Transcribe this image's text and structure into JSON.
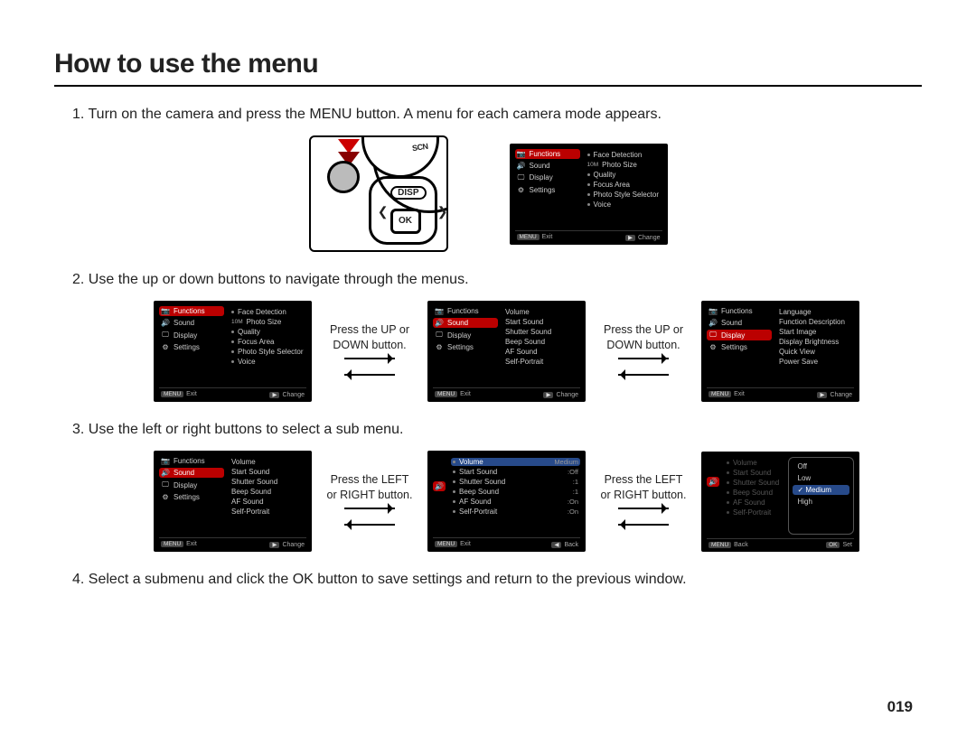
{
  "title": "How to use the menu",
  "page_number": "019",
  "steps": {
    "s1": "1. Turn on the camera and press the MENU button. A menu for each camera mode appears.",
    "s2": "2. Use the up or down buttons to navigate through the menus.",
    "s3": "3. Use the left or right buttons to select a sub menu.",
    "s4": "4. Select a submenu and click the OK button to save settings and return to the previous window."
  },
  "captions": {
    "updown": "Press the UP or DOWN button.",
    "leftright": "Press the LEFT or RIGHT button."
  },
  "camera": {
    "dial_label": "SCN",
    "disp": "DISP",
    "ok": "OK"
  },
  "icons": {
    "functions": "📷",
    "sound": "🔊",
    "display": "🖵",
    "settings": "⚙"
  },
  "menu_footer": {
    "exit_tag": "MENU",
    "exit": "Exit",
    "change_tag": "▶",
    "change": "Change",
    "back_tag": "◀",
    "back": "Back",
    "set_tag": "OK",
    "set": "Set"
  },
  "panels": {
    "p1": {
      "left": [
        {
          "icon": "functions",
          "label": "Functions",
          "sel": true
        },
        {
          "icon": "sound",
          "label": "Sound"
        },
        {
          "icon": "display",
          "label": "Display"
        },
        {
          "icon": "settings",
          "label": "Settings"
        }
      ],
      "right": [
        {
          "bullet": true,
          "label": "Face Detection"
        },
        {
          "pre": "10M",
          "label": "Photo Size"
        },
        {
          "bullet": true,
          "label": "Quality"
        },
        {
          "bullet": true,
          "label": "Focus Area"
        },
        {
          "bullet": true,
          "label": "Photo Style Selector"
        },
        {
          "bullet": true,
          "label": "Voice"
        }
      ]
    },
    "p2a": {
      "left": [
        {
          "icon": "functions",
          "label": "Functions",
          "sel": true
        },
        {
          "icon": "sound",
          "label": "Sound"
        },
        {
          "icon": "display",
          "label": "Display"
        },
        {
          "icon": "settings",
          "label": "Settings"
        }
      ],
      "right": [
        {
          "bullet": true,
          "label": "Face Detection"
        },
        {
          "pre": "10M",
          "label": "Photo Size"
        },
        {
          "bullet": true,
          "label": "Quality"
        },
        {
          "bullet": true,
          "label": "Focus Area"
        },
        {
          "bullet": true,
          "label": "Photo Style Selector"
        },
        {
          "bullet": true,
          "label": "Voice"
        }
      ]
    },
    "p2b": {
      "left": [
        {
          "icon": "functions",
          "label": "Functions"
        },
        {
          "icon": "sound",
          "label": "Sound",
          "sel": true
        },
        {
          "icon": "display",
          "label": "Display"
        },
        {
          "icon": "settings",
          "label": "Settings"
        }
      ],
      "right": [
        {
          "label": "Volume"
        },
        {
          "label": "Start Sound"
        },
        {
          "label": "Shutter Sound"
        },
        {
          "label": "Beep Sound"
        },
        {
          "label": "AF Sound"
        },
        {
          "label": "Self-Portrait"
        }
      ]
    },
    "p2c": {
      "left": [
        {
          "icon": "functions",
          "label": "Functions"
        },
        {
          "icon": "sound",
          "label": "Sound"
        },
        {
          "icon": "display",
          "label": "Display",
          "sel": true
        },
        {
          "icon": "settings",
          "label": "Settings"
        }
      ],
      "right": [
        {
          "label": "Language"
        },
        {
          "label": "Function Description"
        },
        {
          "label": "Start Image"
        },
        {
          "label": "Display Brightness"
        },
        {
          "label": "Quick View"
        },
        {
          "label": "Power Save"
        }
      ]
    },
    "p3a": {
      "left": [
        {
          "icon": "functions",
          "label": "Functions"
        },
        {
          "icon": "sound",
          "label": "Sound",
          "sel": true
        },
        {
          "icon": "display",
          "label": "Display"
        },
        {
          "icon": "settings",
          "label": "Settings"
        }
      ],
      "right": [
        {
          "label": "Volume"
        },
        {
          "label": "Start Sound"
        },
        {
          "label": "Shutter Sound"
        },
        {
          "label": "Beep Sound"
        },
        {
          "label": "AF Sound"
        },
        {
          "label": "Self-Portrait"
        }
      ]
    },
    "p3b": {
      "left_col_header": true,
      "right": [
        {
          "bullet": true,
          "label": "Volume",
          "val": "Medium",
          "sel": true
        },
        {
          "bullet": true,
          "label": "Start Sound",
          "val": ":Off"
        },
        {
          "bullet": true,
          "label": "Shutter Sound",
          "val": ":1"
        },
        {
          "bullet": true,
          "label": "Beep Sound",
          "val": ":1"
        },
        {
          "bullet": true,
          "label": "AF Sound",
          "val": ":On"
        },
        {
          "bullet": true,
          "label": "Self-Portrait",
          "val": ":On"
        }
      ]
    },
    "p3c": {
      "right_dim": [
        {
          "label": "Volume"
        },
        {
          "label": "Start Sound"
        },
        {
          "label": "Shutter Sound"
        },
        {
          "label": "Beep Sound"
        },
        {
          "label": "AF Sound"
        },
        {
          "label": "Self-Portrait"
        }
      ],
      "options": [
        {
          "label": "Off"
        },
        {
          "label": "Low"
        },
        {
          "label": "Medium",
          "sel": true
        },
        {
          "label": "High"
        }
      ]
    }
  }
}
